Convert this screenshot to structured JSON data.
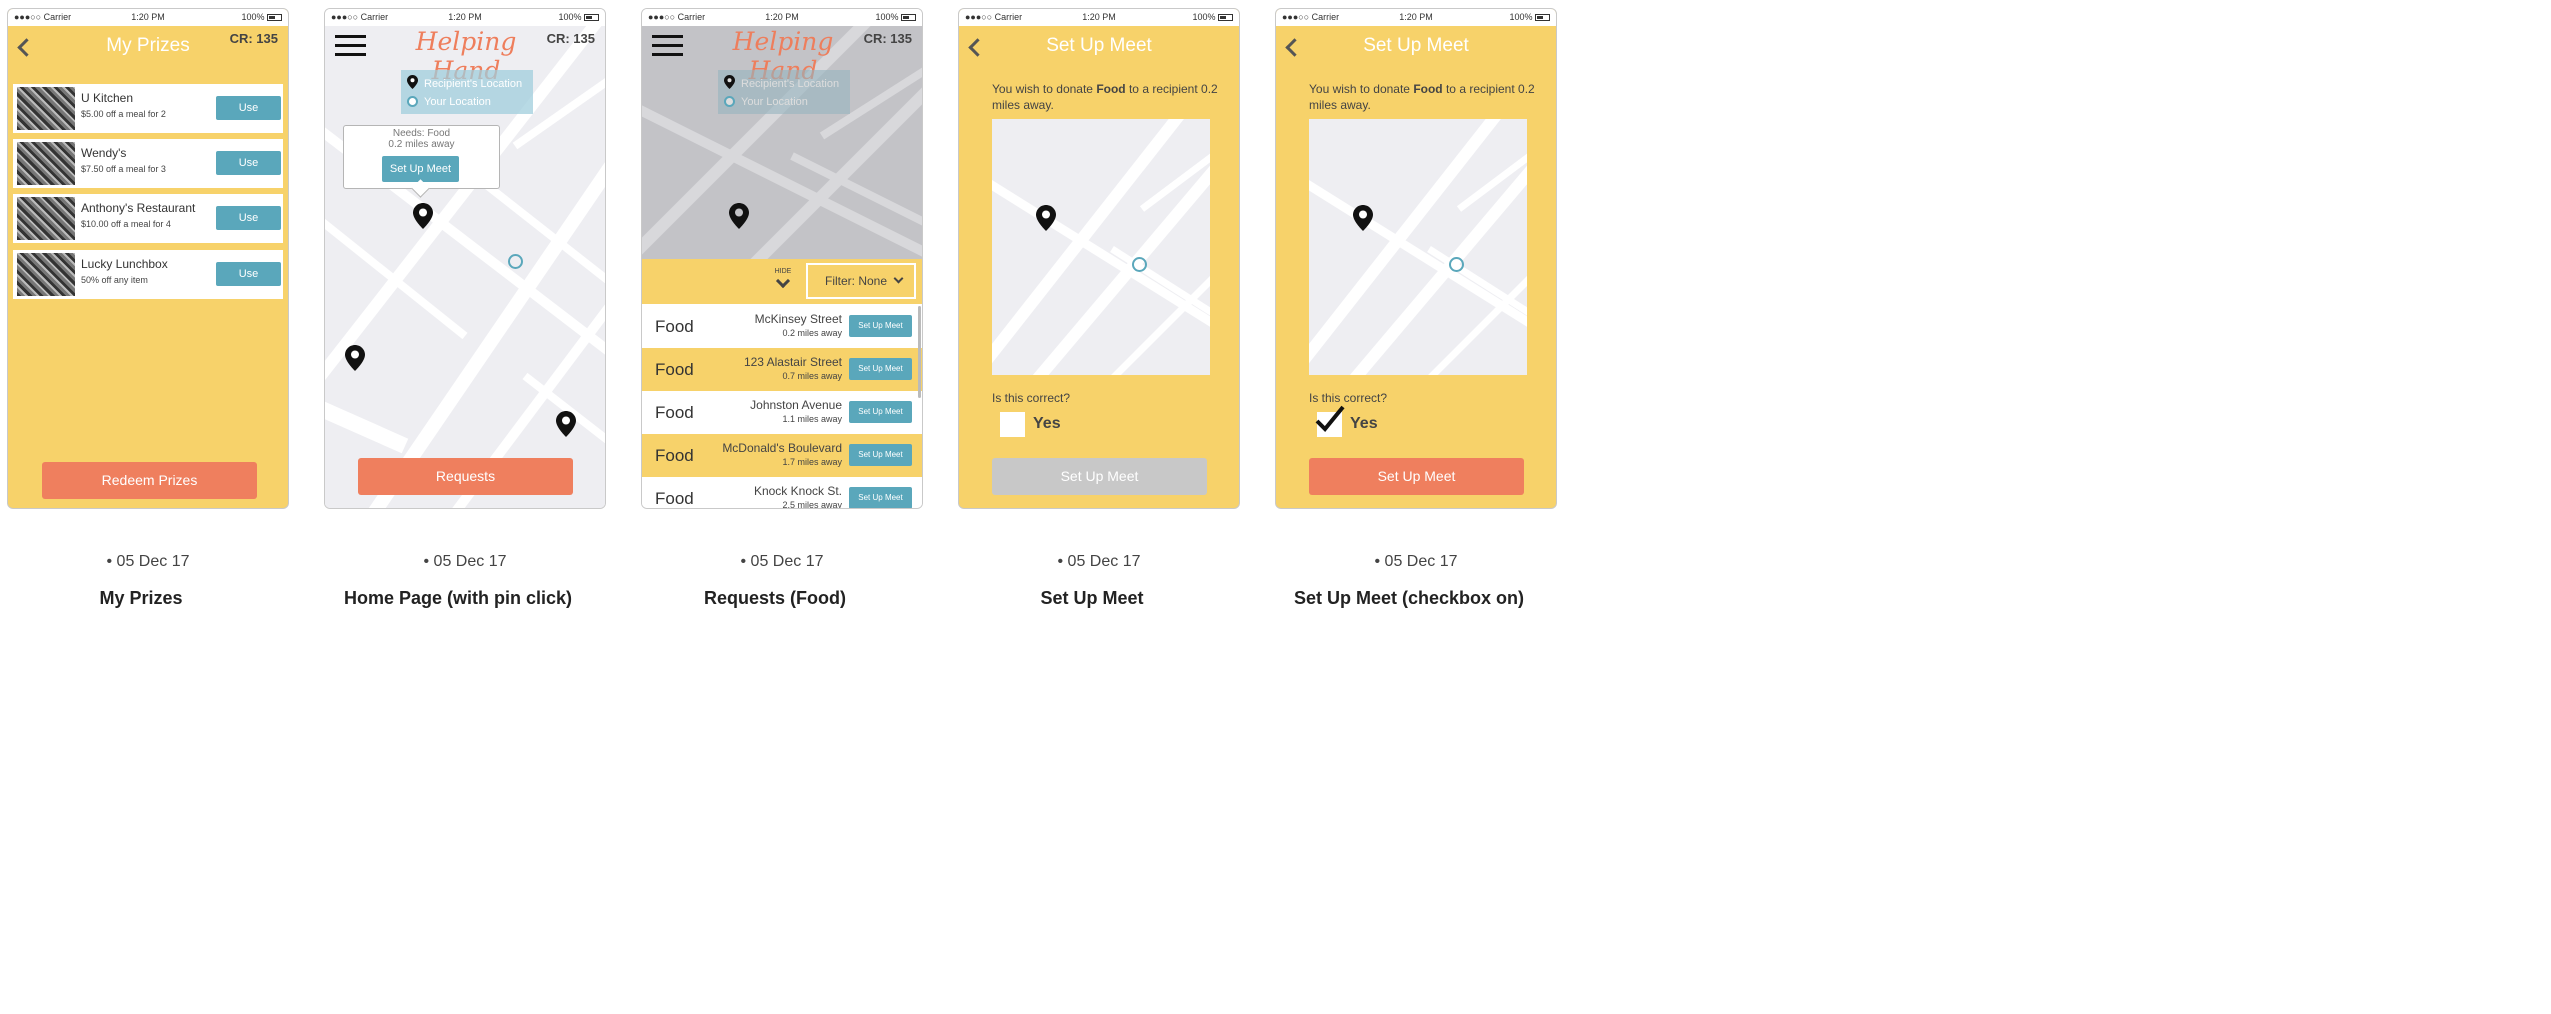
{
  "status": {
    "carrier": "●●●○○ Carrier",
    "time": "1:20 PM",
    "battery": "100%"
  },
  "credits": "CR: 135",
  "brand": {
    "logo_text": "Helping Hand"
  },
  "legend": {
    "recipient": "Recipient's Location",
    "you": "Your Location"
  },
  "screens": [
    {
      "caption_date": "• 05 Dec 17",
      "caption_name": "My Prizes"
    },
    {
      "caption_date": "• 05 Dec 17",
      "caption_name": "Home Page (with pin click)"
    },
    {
      "caption_date": "• 05 Dec 17",
      "caption_name": "Requests (Food)"
    },
    {
      "caption_date": "• 05 Dec 17",
      "caption_name": "Set Up Meet"
    },
    {
      "caption_date": "• 05 Dec 17",
      "caption_name": "Set Up Meet (checkbox on)"
    }
  ],
  "prizes_screen": {
    "title": "My Prizes",
    "use_label": "Use",
    "redeem_label": "Redeem Prizes",
    "items": [
      {
        "name": "U Kitchen",
        "desc": "$5.00 off a meal for 2"
      },
      {
        "name": "Wendy's",
        "desc": "$7.50 off a meal for 3"
      },
      {
        "name": "Anthony's Restaurant",
        "desc": "$10.00 off a meal for 4"
      },
      {
        "name": "Lucky Lunchbox",
        "desc": "50% off any item"
      }
    ]
  },
  "home_screen": {
    "popup_line1": "Needs: Food",
    "popup_line2": "0.2 miles away",
    "popup_button": "Set Up Meet",
    "requests_label": "Requests"
  },
  "requests_screen": {
    "hide_label": "HIDE",
    "filter_label": "Filter: None",
    "meet_label": "Set Up Meet",
    "rows": [
      {
        "type": "Food",
        "street": "McKinsey Street",
        "dist": "0.2 miles away"
      },
      {
        "type": "Food",
        "street": "123 Alastair Street",
        "dist": "0.7 miles away"
      },
      {
        "type": "Food",
        "street": "Johnston Avenue",
        "dist": "1.1 miles away"
      },
      {
        "type": "Food",
        "street": "McDonald's Boulevard",
        "dist": "1.7 miles away"
      },
      {
        "type": "Food",
        "street": "Knock Knock St.",
        "dist": "2.5 miles away"
      }
    ]
  },
  "meet_screen": {
    "title": "Set Up Meet",
    "intro_a": "You wish to donate ",
    "intro_bold": "Food",
    "intro_b": " to a recipient 0.2 miles away.",
    "question": "Is this correct?",
    "yes_label": "Yes",
    "button_label": "Set Up Meet",
    "checked_first": false,
    "checked_second": true
  }
}
